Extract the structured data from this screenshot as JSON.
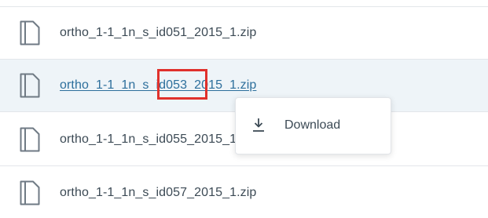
{
  "files": [
    {
      "name": "ortho_1-1_1n_s_id051_2015_1.zip",
      "icon": "file-icon"
    },
    {
      "name": "ortho_1-1_1n_s_id053_2015_1.zip",
      "icon": "file-icon",
      "state": "hovered-link"
    },
    {
      "name": "ortho_1-1_1n_s_id055_2015_1.zip",
      "icon": "file-icon"
    },
    {
      "name": "ortho_1-1_1n_s_id057_2015_1.zip",
      "icon": "file-icon"
    }
  ],
  "context_menu": {
    "items": [
      {
        "label": "Download",
        "icon": "download-icon"
      }
    ]
  },
  "annotation": {
    "highlight_color": "#e0312c"
  },
  "colors": {
    "link": "#2d6f9c",
    "text": "#3c4a55",
    "hover_row": "#eef4f8"
  }
}
